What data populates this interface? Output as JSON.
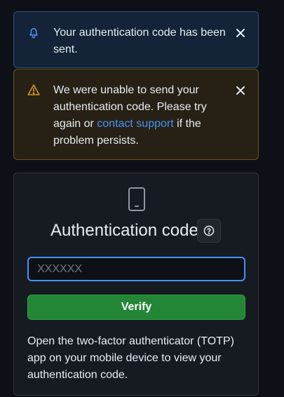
{
  "flash_info": {
    "message": "Your authentication code has been sent.",
    "icon": "bell-icon",
    "close_icon": "close-icon"
  },
  "flash_warning": {
    "message_before": "We were unable to send your authentication code. Please try again or ",
    "link_text": "contact support",
    "message_after": " if the problem persists.",
    "icon": "alert-icon",
    "close_icon": "close-icon"
  },
  "auth": {
    "icon": "device-mobile-icon",
    "title": "Authentication code",
    "help_icon": "question-icon",
    "input": {
      "value": "",
      "placeholder": "XXXXXX"
    },
    "verify_label": "Verify",
    "help_text": "Open the two-factor authenticator (TOTP) app on your mobile device to view your authentication code."
  },
  "colors": {
    "background": "#0d1117",
    "info_bg": "#142337",
    "warning_bg": "#272115",
    "accent_blue": "#4493f8",
    "warning_yellow": "#d29922",
    "button_green": "#238636"
  }
}
